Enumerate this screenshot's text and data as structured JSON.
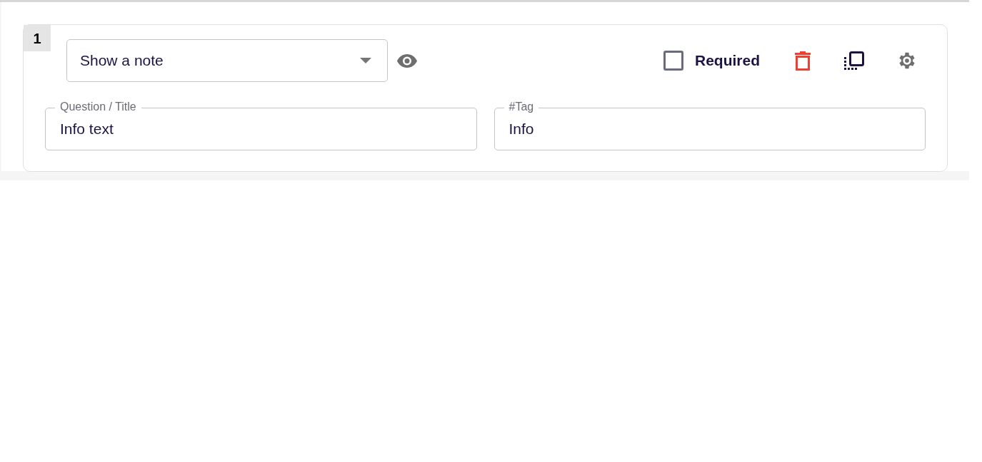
{
  "question": {
    "number": "1",
    "type_select": {
      "value": "Show a note"
    },
    "required": {
      "label": "Required",
      "checked": false
    },
    "fields": [
      {
        "label": "Question / Title",
        "value": "Info text"
      },
      {
        "label": "#Tag",
        "value": "Info"
      }
    ]
  }
}
